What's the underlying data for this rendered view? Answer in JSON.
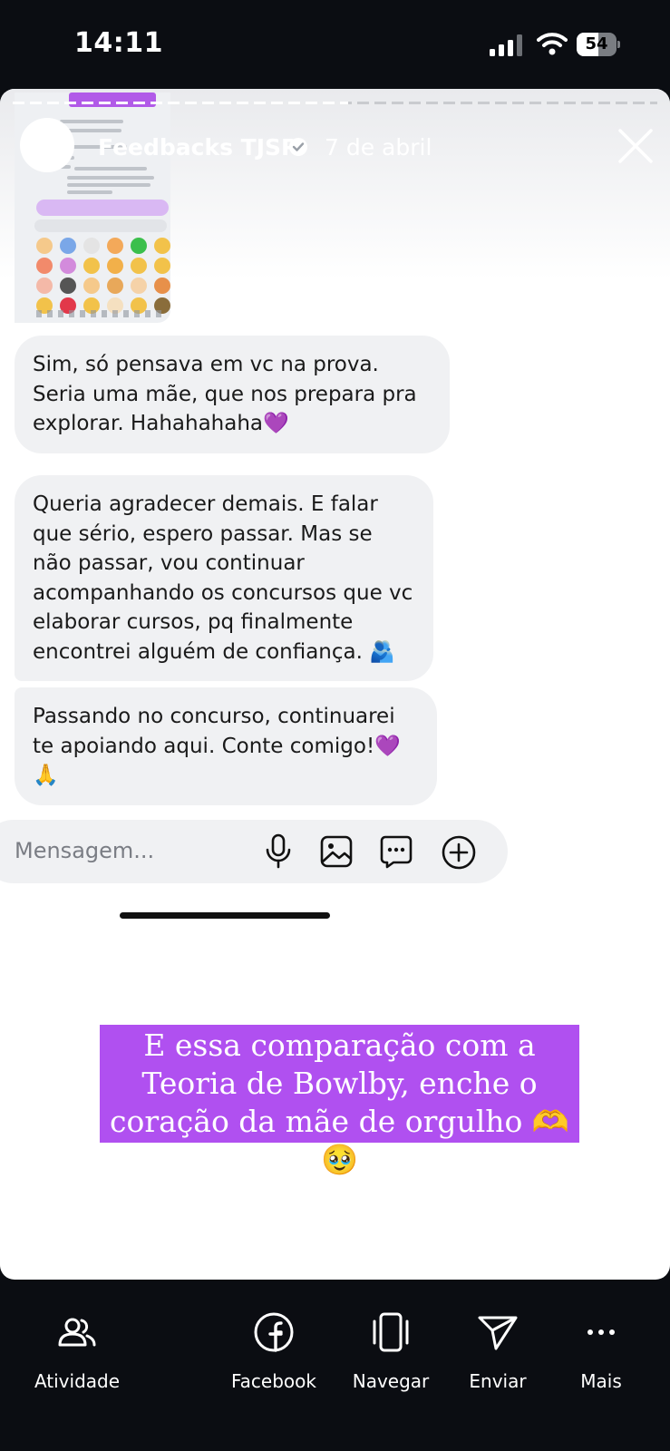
{
  "status_bar": {
    "time": "14:11",
    "battery": "54",
    "battery_level": 0.54
  },
  "story": {
    "progress": 0.52,
    "username": "Feedbacks TJSP",
    "date": "7 de abril",
    "messages": [
      "Sim, só pensava em vc na prova. Seria uma mãe, que nos prepara pra explorar. Hahahahaha💜",
      "Queria agradecer demais. E falar que sério, espero passar. Mas se não passar, vou continuar acompanhando os concursos que vc elaborar cursos, pq finalmente encontrei alguém de confiança. 🫂",
      "Passando no concurso, continuarei te apoiando aqui. Conte comigo!💜🙏"
    ],
    "message_placeholder": "Mensagem...",
    "caption": "E essa comparação com a Teoria de Bowlby, enche o coração da mãe de orgulho 🫶🥹"
  },
  "actions": [
    {
      "label": "Atividade",
      "icon": "people-icon"
    },
    {
      "label": "Facebook",
      "icon": "facebook-icon"
    },
    {
      "label": "Navegar",
      "icon": "navigate-icon"
    },
    {
      "label": "Enviar",
      "icon": "send-icon"
    },
    {
      "label": "Mais",
      "icon": "more-icon"
    }
  ]
}
